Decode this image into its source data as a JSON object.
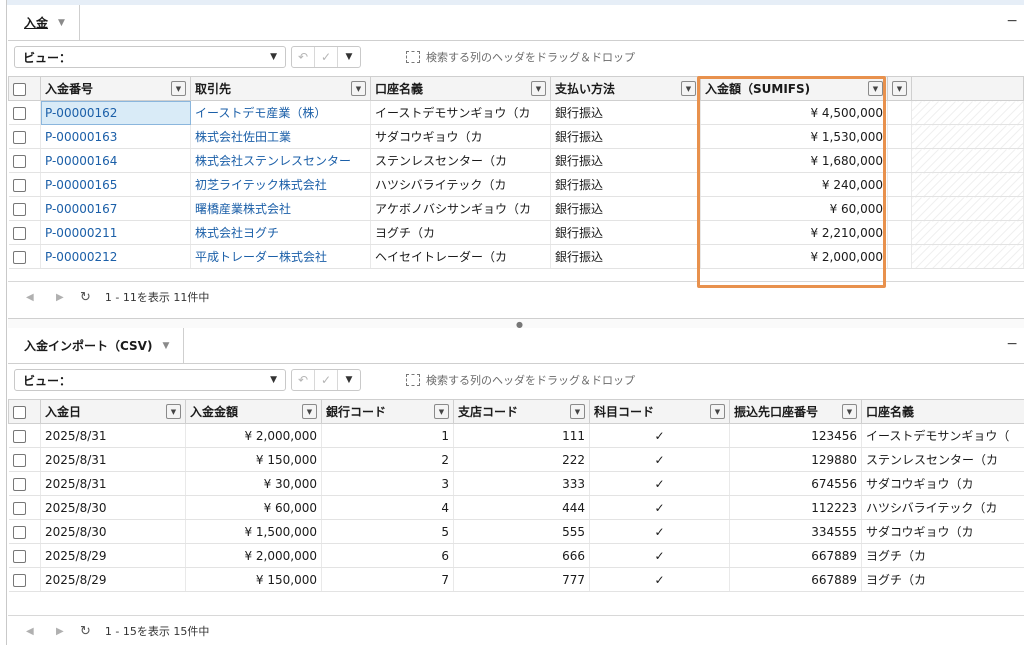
{
  "top": {
    "tab_label": "入金",
    "view_label": "ビュー：",
    "group_hint": "検索する列のヘッダをドラッグ＆ドロップ",
    "columns": [
      "入金番号",
      "取引先",
      "口座名義",
      "支払い方法",
      "入金額（SUMIFS)"
    ],
    "rows": [
      {
        "no": "P-00000162",
        "partner": "イーストデモ産業（株）",
        "account": "イーストデモサンギョウ（カ",
        "method": "銀行振込",
        "amount": "¥ 4,500,000"
      },
      {
        "no": "P-00000163",
        "partner": "株式会社佐田工業",
        "account": "サダコウギョウ（カ",
        "method": "銀行振込",
        "amount": "¥ 1,530,000"
      },
      {
        "no": "P-00000164",
        "partner": "株式会社ステンレスセンター",
        "account": "ステンレスセンター（カ",
        "method": "銀行振込",
        "amount": "¥ 1,680,000"
      },
      {
        "no": "P-00000165",
        "partner": "初芝ライテック株式会社",
        "account": "ハツシバライテック（カ",
        "method": "銀行振込",
        "amount": "¥ 240,000"
      },
      {
        "no": "P-00000167",
        "partner": "曙橋産業株式会社",
        "account": "アケボノバシサンギョウ（カ",
        "method": "銀行振込",
        "amount": "¥ 60,000"
      },
      {
        "no": "P-00000211",
        "partner": "株式会社ヨグチ",
        "account": "ヨグチ（カ",
        "method": "銀行振込",
        "amount": "¥ 2,210,000"
      },
      {
        "no": "P-00000212",
        "partner": "平成トレーダー株式会社",
        "account": "ヘイセイトレーダー（カ",
        "method": "銀行振込",
        "amount": "¥ 2,000,000"
      }
    ],
    "footer_count": "1 - 11を表示 11件中"
  },
  "bottom": {
    "tab_label": "入金インポート（CSV)",
    "view_label": "ビュー：",
    "group_hint": "検索する列のヘッダをドラッグ＆ドロップ",
    "columns": [
      "入金日",
      "入金金額",
      "銀行コード",
      "支店コード",
      "科目コード",
      "振込先口座番号",
      "口座名義"
    ],
    "rows": [
      {
        "date": "2025/8/31",
        "amount": "¥ 2,000,000",
        "bank": "1",
        "branch": "111",
        "subject": "✓",
        "acct": "123456",
        "name": "イーストデモサンギョウ（"
      },
      {
        "date": "2025/8/31",
        "amount": "¥ 150,000",
        "bank": "2",
        "branch": "222",
        "subject": "✓",
        "acct": "129880",
        "name": "ステンレスセンター（カ"
      },
      {
        "date": "2025/8/31",
        "amount": "¥ 30,000",
        "bank": "3",
        "branch": "333",
        "subject": "✓",
        "acct": "674556",
        "name": "サダコウギョウ（カ"
      },
      {
        "date": "2025/8/30",
        "amount": "¥ 60,000",
        "bank": "4",
        "branch": "444",
        "subject": "✓",
        "acct": "112223",
        "name": "ハツシバライテック（カ"
      },
      {
        "date": "2025/8/30",
        "amount": "¥ 1,500,000",
        "bank": "5",
        "branch": "555",
        "subject": "✓",
        "acct": "334555",
        "name": "サダコウギョウ（カ"
      },
      {
        "date": "2025/8/29",
        "amount": "¥ 2,000,000",
        "bank": "6",
        "branch": "666",
        "subject": "✓",
        "acct": "667889",
        "name": "ヨグチ（カ"
      },
      {
        "date": "2025/8/29",
        "amount": "¥ 150,000",
        "bank": "7",
        "branch": "777",
        "subject": "✓",
        "acct": "667889",
        "name": "ヨグチ（カ"
      }
    ],
    "footer_count": "1 - 15を表示 15件中"
  },
  "icons": {
    "undo": "↶",
    "check": "✓",
    "caret": "▼",
    "prev": "◀",
    "next": "▶",
    "refresh": "↻"
  },
  "colors": {
    "link": "#1b5fa8",
    "highlight": "#e8914d",
    "selected_cell": "#d9ebf7"
  }
}
